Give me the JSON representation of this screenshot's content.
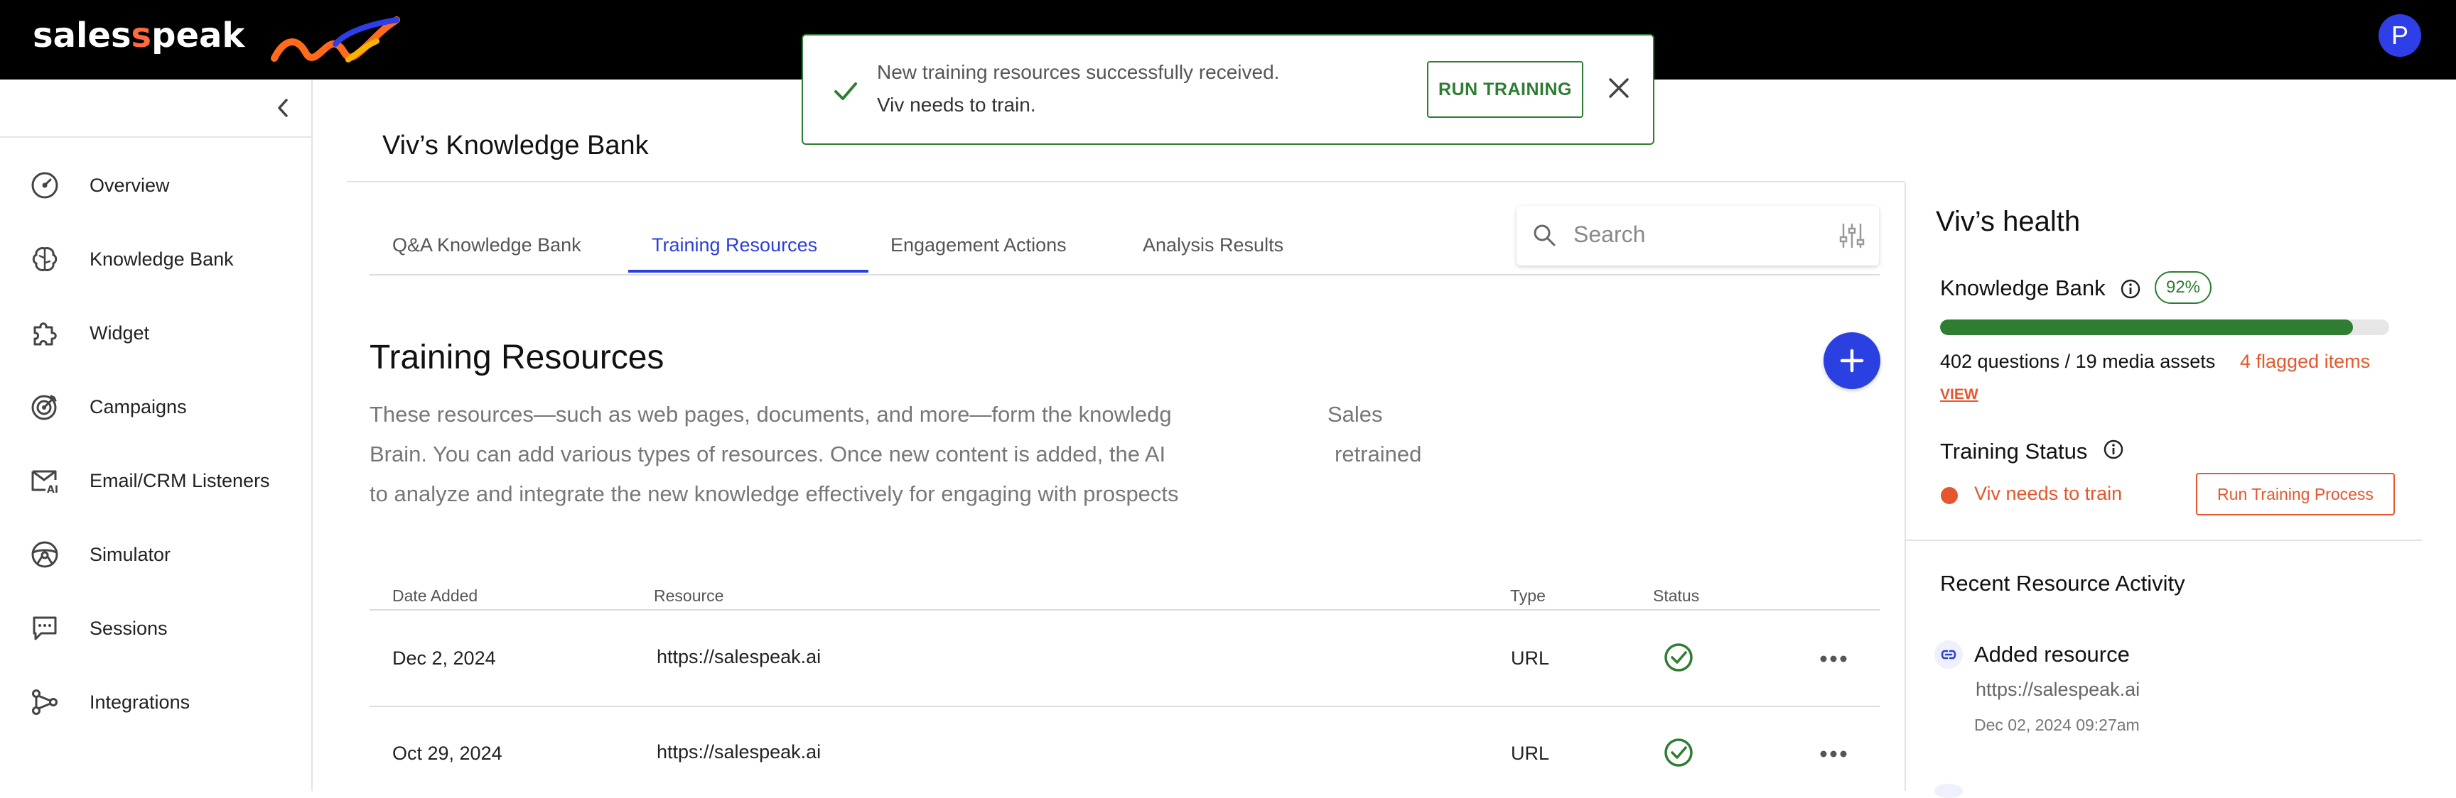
{
  "app": {
    "logo_text_pre": "sales",
    "logo_text_post": "peak",
    "avatar_initial": "P",
    "accent_color": "#2a40d8",
    "success_color": "#2e7d32",
    "alert_color": "#e4572e"
  },
  "toast": {
    "line1": "New training resources successfully received.",
    "line2": "Viv needs to train.",
    "button_label": "RUN TRAINING"
  },
  "sidebar": {
    "items": [
      {
        "label": "Overview",
        "icon": "gauge-icon"
      },
      {
        "label": "Knowledge Bank",
        "icon": "brain-icon"
      },
      {
        "label": "Widget",
        "icon": "puzzle-icon"
      },
      {
        "label": "Campaigns",
        "icon": "target-icon"
      },
      {
        "label": "Email/CRM Listeners",
        "icon": "mail-ai-icon"
      },
      {
        "label": "Simulator",
        "icon": "steering-wheel-icon"
      },
      {
        "label": "Sessions",
        "icon": "chat-icon"
      },
      {
        "label": "Integrations",
        "icon": "nodes-icon"
      }
    ]
  },
  "main": {
    "title": "Viv’s Knowledge Bank",
    "tabs": [
      {
        "label": "Q&A Knowledge Bank",
        "active": false
      },
      {
        "label": "Training Resources",
        "active": true
      },
      {
        "label": "Engagement Actions",
        "active": false
      },
      {
        "label": "Analysis Results",
        "active": false
      }
    ],
    "search_placeholder": "Search",
    "section_title": "Training Resources",
    "description": {
      "line1a": "These resources—such as web pages, documents, and more—form the knowledg",
      "line1b": "Sales",
      "line2a": "Brain. You can add various types of resources. Once new content is added, the AI",
      "line2b": "retrained",
      "line3": "to analyze and integrate the new knowledge effectively for engaging with prospects"
    },
    "table": {
      "headers": [
        "Date Added",
        "Resource",
        "Type",
        "Status"
      ],
      "rows": [
        {
          "date": "Dec 2, 2024",
          "resource": "https://salespeak.ai",
          "type": "URL",
          "status": "complete"
        },
        {
          "date": "Oct 29, 2024",
          "resource": "https://salespeak.ai",
          "type": "URL",
          "status": "complete"
        }
      ]
    }
  },
  "health": {
    "title": "Viv’s health",
    "kb_label": "Knowledge Bank",
    "kb_percent": "92%",
    "kb_fraction": 0.92,
    "assets_text": "402 questions / 19 media assets",
    "flagged_text": "4 flagged items",
    "view_label": "VIEW",
    "training_status_label": "Training Status",
    "training_status_value": "Viv needs to train",
    "run_process_label": "Run Training Process",
    "recent_title": "Recent Resource Activity",
    "activity": {
      "title": "Added resource",
      "url": "https://salespeak.ai",
      "date": "Dec 02, 2024 09:27am"
    }
  }
}
